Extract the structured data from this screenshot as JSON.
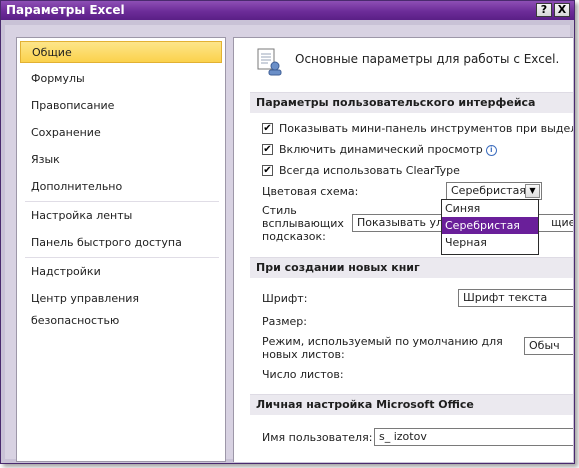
{
  "window": {
    "title": "Параметры Excel",
    "help_label": "?",
    "close_label": "X"
  },
  "nav": {
    "items": [
      {
        "label": "Общие"
      },
      {
        "label": "Формулы"
      },
      {
        "label": "Правописание"
      },
      {
        "label": "Сохранение"
      },
      {
        "label": "Язык"
      },
      {
        "label": "Дополнительно"
      },
      {
        "label": "Настройка ленты"
      },
      {
        "label": "Панель быстрого доступа"
      },
      {
        "label": "Надстройки"
      },
      {
        "label": "Центр управления безопасностью"
      }
    ],
    "selected": "Общие"
  },
  "main": {
    "heading": "Основные параметры для работы с Excel.",
    "ui_section": {
      "title": "Параметры пользовательского интерфейса",
      "checks": [
        {
          "label": "Показывать мини-панель инструментов при выдел",
          "checked": true,
          "mark": "✔"
        },
        {
          "label": "Включить динамический просмотр",
          "checked": true,
          "mark": "✔"
        },
        {
          "label": "Всегда использовать ClearType",
          "checked": true,
          "mark": "✔"
        }
      ],
      "color_scheme_label": "Цветовая схема:",
      "color_scheme_value": "Серебристая",
      "color_scheme_options": [
        "Синяя",
        "Серебристая",
        "Черная"
      ],
      "color_scheme_highlighted": "Серебристая",
      "tooltip_style_label_1": "Стиль",
      "tooltip_style_label_2": "всплывающих",
      "tooltip_style_label_3": "подсказок:",
      "tooltip_style_value": "Показывать улуч",
      "tooltip_style_value_tail": "щие"
    },
    "new_book_section": {
      "title": "При создании новых книг",
      "font_label": "Шрифт:",
      "font_value": "Шрифт текста",
      "size_label": "Размер:",
      "view_label_1": "Режим, используемый по умолчанию для",
      "view_label_2": "новых листов:",
      "view_value": "Обыч",
      "sheets_label": "Число листов:"
    },
    "office_section": {
      "title": "Личная настройка Microsoft Office",
      "username_label": "Имя пользователя:",
      "username_value": "s_ izotov"
    }
  },
  "colors": {
    "titlebar": "#6c2c98",
    "selected_nav": "#fbd24c",
    "dropdown_highlight": "#6a1f9a"
  },
  "icons": [
    "info-icon",
    "options-page-icon",
    "chevron-down-icon"
  ]
}
